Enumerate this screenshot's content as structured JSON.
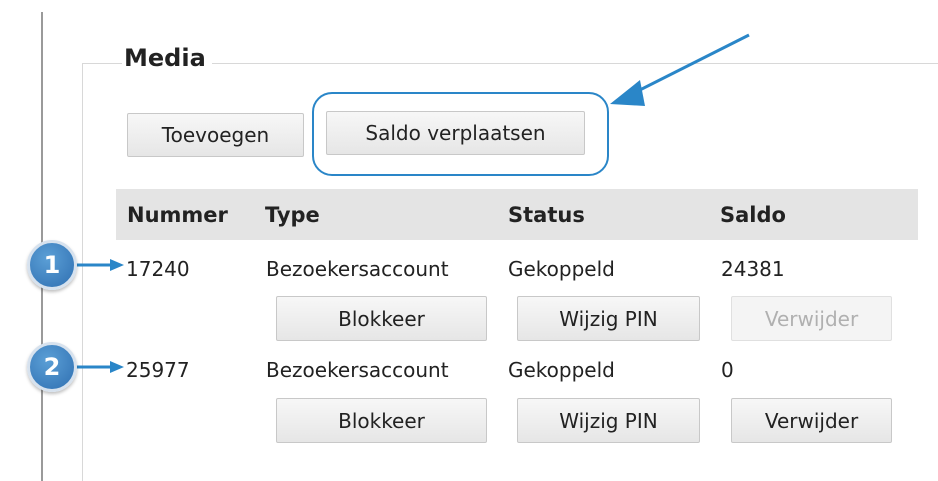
{
  "section": {
    "title": "Media",
    "add_button": "Toevoegen",
    "move_balance_button": "Saldo verplaatsen"
  },
  "table": {
    "columns": [
      "Nummer",
      "Type",
      "Status",
      "Saldo"
    ],
    "rows": [
      {
        "number": "17240",
        "type": "Bezoekersaccount",
        "status": "Gekoppeld",
        "balance": "24381",
        "block_button": "Blokkeer",
        "change_pin_button": "Wijzig PIN",
        "delete_button": "Verwijder",
        "delete_enabled": false,
        "marker": "1"
      },
      {
        "number": "25977",
        "type": "Bezoekersaccount",
        "status": "Gekoppeld",
        "balance": "0",
        "block_button": "Blokkeer",
        "change_pin_button": "Wijzig PIN",
        "delete_button": "Verwijder",
        "delete_enabled": true,
        "marker": "2"
      }
    ]
  },
  "colors": {
    "annotation": "#2a86c8",
    "header_bg": "#e4e4e4"
  }
}
